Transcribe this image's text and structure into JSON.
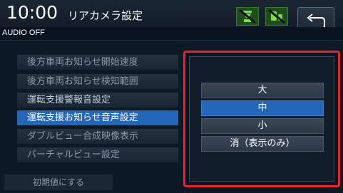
{
  "header": {
    "time": "10:00",
    "title": "リアカメラ設定",
    "icons": [
      "camera-status-icon",
      "car-status-icon"
    ],
    "back_icon": "return-arrow-icon"
  },
  "audio_status": "AUDIO OFF",
  "menu": {
    "items": [
      {
        "label": "後方車両お知らせ開始速度"
      },
      {
        "label": "後方車両お知らせ検知範囲"
      },
      {
        "label": "運転支援警報音設定"
      },
      {
        "label": "運転支援お知らせ音声設定",
        "selected": true
      },
      {
        "label": "ダブルビュー合成映像表示"
      },
      {
        "label": "バーチャルビュー設定"
      }
    ],
    "reset_label": "初期値にする"
  },
  "popup": {
    "options": [
      {
        "label": "大"
      },
      {
        "label": "中",
        "selected": true
      },
      {
        "label": "小"
      },
      {
        "label": "消（表示のみ）"
      }
    ],
    "highlight_color": "#e3262b"
  },
  "colors": {
    "accent": "#2466b8",
    "background": "#0e1926"
  }
}
